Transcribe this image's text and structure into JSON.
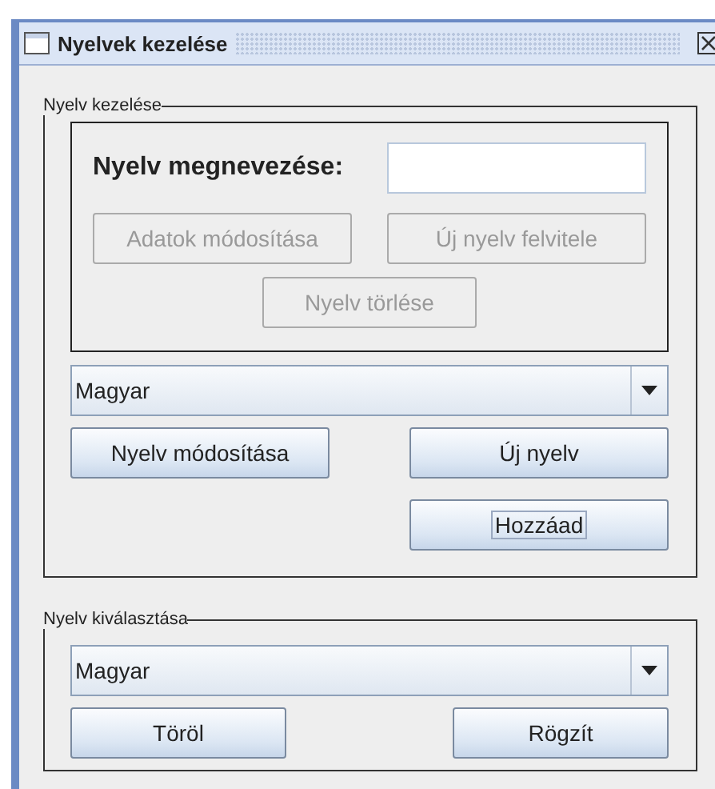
{
  "window": {
    "title": "Nyelvek kezelése"
  },
  "language_management": {
    "title": "Nyelv kezelése",
    "name_label": "Nyelv megnevezése:",
    "edit_buttons": [
      {
        "label": "Adatok módosítása",
        "disabled": true,
        "focused": false
      },
      {
        "label": "Új nyelv felvitele",
        "disabled": true,
        "focused": false
      },
      {
        "label": "Nyelv törlése",
        "disabled": true,
        "focused": false
      }
    ],
    "combo": {
      "value": "Magyar"
    },
    "buttons": [
      {
        "label": "Nyelv módosítása",
        "disabled": false,
        "focused": false
      },
      {
        "label": "Új nyelv",
        "disabled": false,
        "focused": false
      },
      {
        "label": "Hozzáad",
        "disabled": false,
        "focused": true
      }
    ]
  },
  "language_selection": {
    "title": "Nyelv kiválasztása",
    "combo": {
      "value": "Magyar"
    },
    "buttons": [
      {
        "label": "Töröl",
        "disabled": false,
        "focused": false
      },
      {
        "label": "Rögzít",
        "disabled": false,
        "focused": false
      }
    ]
  }
}
